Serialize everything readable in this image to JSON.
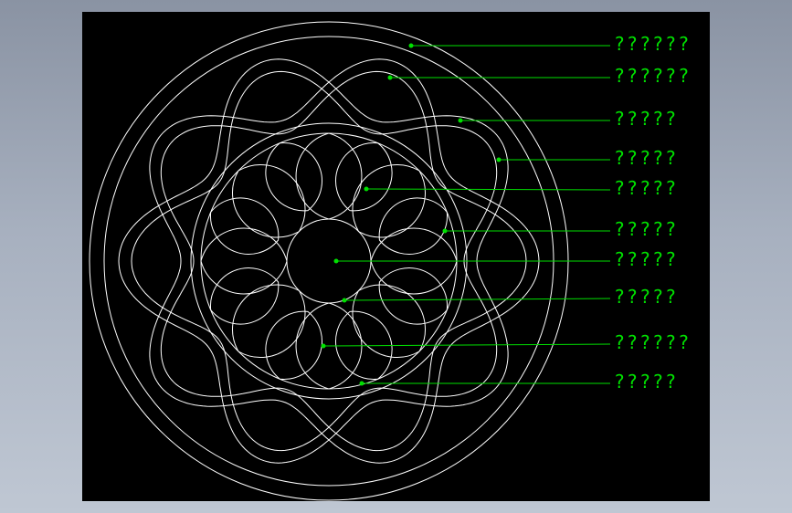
{
  "colors": {
    "background": "#000000",
    "drawing_line": "#ffffff",
    "leader": "#00e000",
    "label_text": "#00e000"
  },
  "callouts": [
    {
      "label": "??????"
    },
    {
      "label": "??????"
    },
    {
      "label": "?????"
    },
    {
      "label": "?????"
    },
    {
      "label": "?????"
    },
    {
      "label": "?????"
    },
    {
      "label": "?????"
    },
    {
      "label": "?????"
    },
    {
      "label": "??????"
    },
    {
      "label": "?????"
    }
  ]
}
